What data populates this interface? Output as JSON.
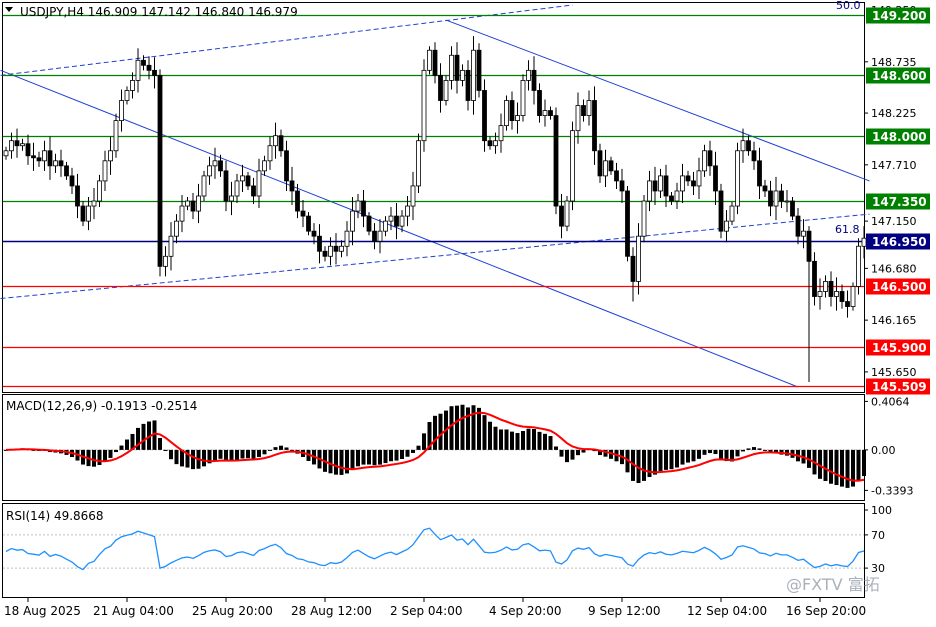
{
  "header": {
    "symbol_info": "USDJPY,H4  146.909 147.142 146.840 146.979",
    "fib_top_label": "50.0",
    "fib_mid_label": "61.8"
  },
  "chart_data": [
    {
      "id": "price",
      "type": "candlestick",
      "ylim": [
        145.45,
        149.32
      ],
      "y_ticks": [
        148.735,
        148.225,
        147.71,
        147.15,
        146.68,
        146.165,
        145.65
      ],
      "y_ticks_faint": [
        149.25,
        146.979
      ],
      "levels": [
        {
          "value": 149.2,
          "label": "149.200",
          "color": "#008000"
        },
        {
          "value": 148.6,
          "label": "148.600",
          "color": "#008000"
        },
        {
          "value": 148.0,
          "label": "148.000",
          "color": "#008000"
        },
        {
          "value": 147.35,
          "label": "147.350",
          "color": "#008000"
        },
        {
          "value": 146.95,
          "label": "146.950",
          "color": "#000080"
        },
        {
          "value": 146.5,
          "label": "146.500",
          "color": "#ff0000"
        },
        {
          "value": 145.9,
          "label": "145.900",
          "color": "#ff0000"
        },
        {
          "value": 145.509,
          "label": "145.509",
          "color": "#ff0000"
        }
      ],
      "closes": [
        147.85,
        147.95,
        147.9,
        147.92,
        147.8,
        147.78,
        147.75,
        147.85,
        147.7,
        147.75,
        147.7,
        147.6,
        147.5,
        147.3,
        147.15,
        147.3,
        147.35,
        147.55,
        147.75,
        147.85,
        148.15,
        148.35,
        148.45,
        148.55,
        148.75,
        148.7,
        148.65,
        148.6,
        146.7,
        146.8,
        147.0,
        147.15,
        147.3,
        147.35,
        147.25,
        147.4,
        147.6,
        147.7,
        147.75,
        147.65,
        147.35,
        147.4,
        147.55,
        147.6,
        147.5,
        147.4,
        147.65,
        147.75,
        147.9,
        148.0,
        147.85,
        147.55,
        147.45,
        147.25,
        147.2,
        147.05,
        147.0,
        146.85,
        146.8,
        146.9,
        146.85,
        146.9,
        147.05,
        147.25,
        147.35,
        147.2,
        147.05,
        146.95,
        147.05,
        147.15,
        147.2,
        147.1,
        147.2,
        147.3,
        147.5,
        147.95,
        148.65,
        148.85,
        148.6,
        148.35,
        148.55,
        148.8,
        148.55,
        148.65,
        148.35,
        148.85,
        148.45,
        147.95,
        147.9,
        147.95,
        148.1,
        148.35,
        148.15,
        148.2,
        148.55,
        148.65,
        148.45,
        148.2,
        148.25,
        148.2,
        147.3,
        147.1,
        147.35,
        148.05,
        148.3,
        148.2,
        148.35,
        147.85,
        147.6,
        147.75,
        147.65,
        147.55,
        147.45,
        146.8,
        146.55,
        147.0,
        147.35,
        147.55,
        147.45,
        147.6,
        147.4,
        147.35,
        147.45,
        147.6,
        147.55,
        147.5,
        147.65,
        147.85,
        147.7,
        147.45,
        147.05,
        147.15,
        147.3,
        147.85,
        147.95,
        147.85,
        147.75,
        147.5,
        147.45,
        147.3,
        147.45,
        147.35,
        147.35,
        147.2,
        147.0,
        147.05,
        146.75,
        146.4,
        146.45,
        146.55,
        146.4,
        146.45,
        146.35,
        146.3,
        146.5,
        146.9,
        146.98
      ],
      "x_ticks": [
        {
          "label": "18 Aug 2025",
          "bar": 4
        },
        {
          "label": "21 Aug 04:00",
          "bar": 22
        },
        {
          "label": "25 Aug 20:00",
          "bar": 40
        },
        {
          "label": "28 Aug 12:00",
          "bar": 58
        },
        {
          "label": "2 Sep 04:00",
          "bar": 76
        },
        {
          "label": "4 Sep 20:00",
          "bar": 94
        },
        {
          "label": "9 Sep 12:00",
          "bar": 112
        },
        {
          "label": "12 Sep 04:00",
          "bar": 130
        },
        {
          "label": "16 Sep 20:00",
          "bar": 148
        }
      ]
    },
    {
      "id": "macd",
      "type": "histogram+line",
      "title": "MACD(12,26,9) -0.1913 -0.2514",
      "ylim": [
        -0.42,
        0.46
      ],
      "y_ticks": [
        {
          "value": 0.4064,
          "label": "0.4064"
        },
        {
          "value": 0.0,
          "label": "0.00"
        },
        {
          "value": -0.3393,
          "label": "-0.3393"
        }
      ],
      "signal_color": "#ff0000",
      "histogram_color": "#000000"
    },
    {
      "id": "rsi",
      "type": "line",
      "title": "RSI(14) 49.8668",
      "ylim": [
        0,
        100
      ],
      "y_ticks": [
        {
          "value": 100,
          "label": "100"
        },
        {
          "value": 70,
          "label": "70"
        },
        {
          "value": 30,
          "label": "30"
        }
      ],
      "line_color": "#1e90ff"
    }
  ],
  "watermark": {
    "text": "@FXTV 富拓"
  }
}
